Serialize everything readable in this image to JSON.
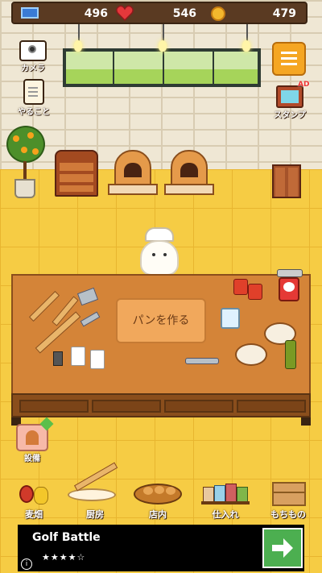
{
  "stats": {
    "tickets": "496",
    "hearts": "546",
    "coins": "479"
  },
  "side_buttons": {
    "camera": "カメラ",
    "todo": "やること",
    "stamp": "スタンプ",
    "stamp_badge": "AD",
    "equipment": "設備"
  },
  "table": {
    "make_bread_label": "パンを作る"
  },
  "nav": [
    {
      "label": "麦畑",
      "icon": "wheat-field-icon"
    },
    {
      "label": "厨房",
      "icon": "kitchen-icon"
    },
    {
      "label": "店内",
      "icon": "shop-icon"
    },
    {
      "label": "仕入れ",
      "icon": "supplies-icon"
    },
    {
      "label": "もちもの",
      "icon": "inventory-icon"
    }
  ],
  "ad": {
    "title": "Golf Battle",
    "stars": "★★★★☆",
    "info": "i"
  },
  "colors": {
    "floor": "#f6cc44",
    "table": "#d48438",
    "wall": "#efe7d4",
    "topbar": "#5a3a22",
    "menu_button": "#f5a623",
    "ad_button": "#4caf50"
  }
}
